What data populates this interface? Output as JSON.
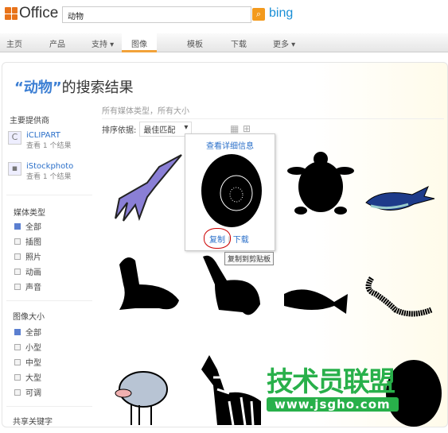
{
  "header": {
    "logo": "Office",
    "search_value": "动物",
    "search_engine": "bing"
  },
  "nav": [
    {
      "label": "主页"
    },
    {
      "label": "产品"
    },
    {
      "label": "支持 ▾"
    },
    {
      "label": "图像",
      "active": true
    },
    {
      "label": "模板"
    },
    {
      "label": "下载"
    },
    {
      "label": "更多 ▾"
    }
  ],
  "title": {
    "query": "“动物”",
    "suffix": "的搜索结果"
  },
  "sidebar": {
    "providers_heading": "主要提供商",
    "providers": [
      {
        "name": "iCLIPART",
        "count": "查看 1 个结果"
      },
      {
        "name": "iStockphoto",
        "count": "查看 1 个结果"
      }
    ],
    "media_heading": "媒体类型",
    "media": [
      {
        "label": "全部",
        "checked": true
      },
      {
        "label": "插图"
      },
      {
        "label": "照片"
      },
      {
        "label": "动画"
      },
      {
        "label": "声音"
      }
    ],
    "size_heading": "图像大小",
    "sizes": [
      {
        "label": "全部",
        "checked": true
      },
      {
        "label": "小型"
      },
      {
        "label": "中型"
      },
      {
        "label": "大型"
      },
      {
        "label": "可调"
      }
    ],
    "shared_heading": "共享关键字"
  },
  "results": {
    "filter": "所有媒体类型，所有大小",
    "sort_label": "排序依据:",
    "sort_value": "最佳匹配",
    "images": [
      "squid",
      "ammonite",
      "turtle",
      "whale",
      "walrus",
      "sea lion",
      "sperm whale",
      "worm",
      "sheep",
      "zebra",
      "fish",
      "tire"
    ]
  },
  "popup": {
    "details": "查看详细信息",
    "copy": "复制",
    "sep": "|",
    "download": "下载",
    "tooltip": "复制到剪贴板"
  },
  "watermark": {
    "text": "技术员联盟",
    "url": "www.jsgho.com"
  }
}
